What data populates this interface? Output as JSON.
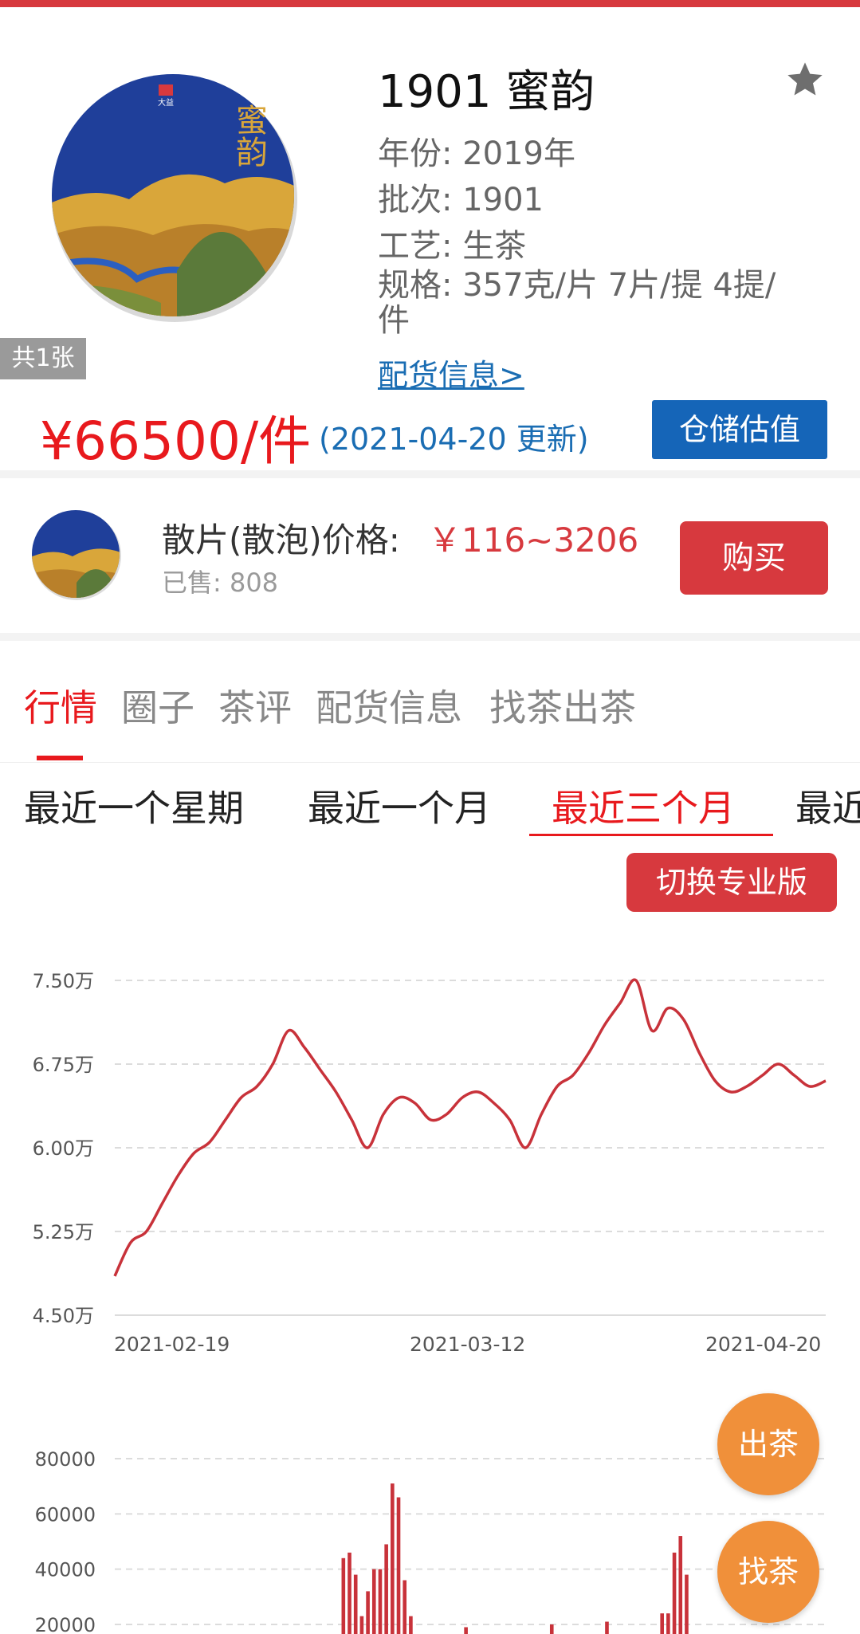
{
  "product": {
    "title": "1901 蜜韵",
    "year": "年份: 2019年",
    "batch": "批次: 1901",
    "craft": "工艺: 生茶",
    "spec": "规格: 357克/片 7片/提 4提/件",
    "distribution_link": "配货信息>",
    "image_count": "共1张",
    "cake_text": "蜜韵",
    "brand_text": "大益",
    "price": "¥66500/件",
    "updated": "(2021-04-20 更新)",
    "storage_button": "仓储估值"
  },
  "loose": {
    "label": "散片(散泡)价格:",
    "price": "￥116~3206",
    "sold": "已售: 808",
    "buy_button": "购买"
  },
  "tabs": [
    {
      "label": "行情",
      "active": true
    },
    {
      "label": "圈子",
      "active": false
    },
    {
      "label": "茶评",
      "active": false
    },
    {
      "label": "配货信息",
      "active": false
    },
    {
      "label": "找茶出茶",
      "active": false
    }
  ],
  "ranges": [
    {
      "label": "最近一个星期",
      "active": false
    },
    {
      "label": "最近一个月",
      "active": false
    },
    {
      "label": "最近三个月",
      "active": true
    },
    {
      "label": "最近",
      "active": false
    }
  ],
  "pro_button": "切换专业版",
  "fabs": {
    "sell": "出茶",
    "find": "找茶"
  },
  "colors": {
    "brand_red": "#d7393e",
    "price_red": "#e8191d",
    "link_blue": "#1a6db3",
    "button_blue": "#1565b8",
    "fab_orange": "#f0903a"
  },
  "chart_data": [
    {
      "type": "line",
      "ytick_labels": [
        "7.50万",
        "6.75万",
        "6.00万",
        "5.25万",
        "4.50万"
      ],
      "ytick_values": [
        75000,
        67500,
        60000,
        52500,
        45000
      ],
      "ylim": [
        45000,
        75000
      ],
      "xtick_labels": [
        "2021-02-19",
        "2021-03-12",
        "2021-04-20"
      ],
      "grid": true,
      "series": [
        {
          "color": "#c8323a",
          "values": [
            48500,
            51500,
            52500,
            55000,
            57500,
            59500,
            60500,
            62500,
            64500,
            65500,
            67500,
            70500,
            69000,
            67000,
            65000,
            62500,
            60000,
            63000,
            64500,
            64000,
            62500,
            63000,
            64500,
            65000,
            64000,
            62500,
            60000,
            63000,
            65500,
            66500,
            68500,
            71000,
            73000,
            75000,
            70500,
            72500,
            71500,
            68500,
            66000,
            65000,
            65500,
            66500,
            67500,
            66500,
            65500,
            66000
          ]
        }
      ]
    },
    {
      "type": "bar",
      "ytick_labels": [
        "80000",
        "60000",
        "40000",
        "20000"
      ],
      "ytick_values": [
        80000,
        60000,
        40000,
        20000
      ],
      "ylim": [
        15000,
        85000
      ],
      "grid": true,
      "series": [
        {
          "color": "#c8323a",
          "values": [
            0,
            0,
            0,
            0,
            0,
            0,
            0,
            0,
            0,
            0,
            0,
            0,
            0,
            0,
            0,
            0,
            0,
            0,
            0,
            0,
            0,
            0,
            0,
            0,
            0,
            0,
            0,
            0,
            0,
            0,
            0,
            0,
            0,
            0,
            0,
            0,
            0,
            44000,
            46000,
            38000,
            23000,
            32000,
            40000,
            40000,
            49000,
            71000,
            66000,
            36000,
            23000,
            0,
            0,
            0,
            0,
            0,
            0,
            0,
            0,
            19000,
            0,
            0,
            0,
            0,
            0,
            0,
            0,
            0,
            0,
            0,
            0,
            0,
            0,
            20000,
            0,
            0,
            0,
            0,
            0,
            0,
            0,
            0,
            21000,
            0,
            0,
            0,
            0,
            0,
            0,
            0,
            0,
            24000,
            24000,
            46000,
            52000,
            38000,
            0,
            0,
            0,
            0,
            0,
            0,
            0,
            0,
            0,
            0,
            0,
            0,
            0,
            0,
            0,
            0,
            0,
            0,
            0,
            0,
            0,
            0
          ]
        }
      ]
    }
  ]
}
